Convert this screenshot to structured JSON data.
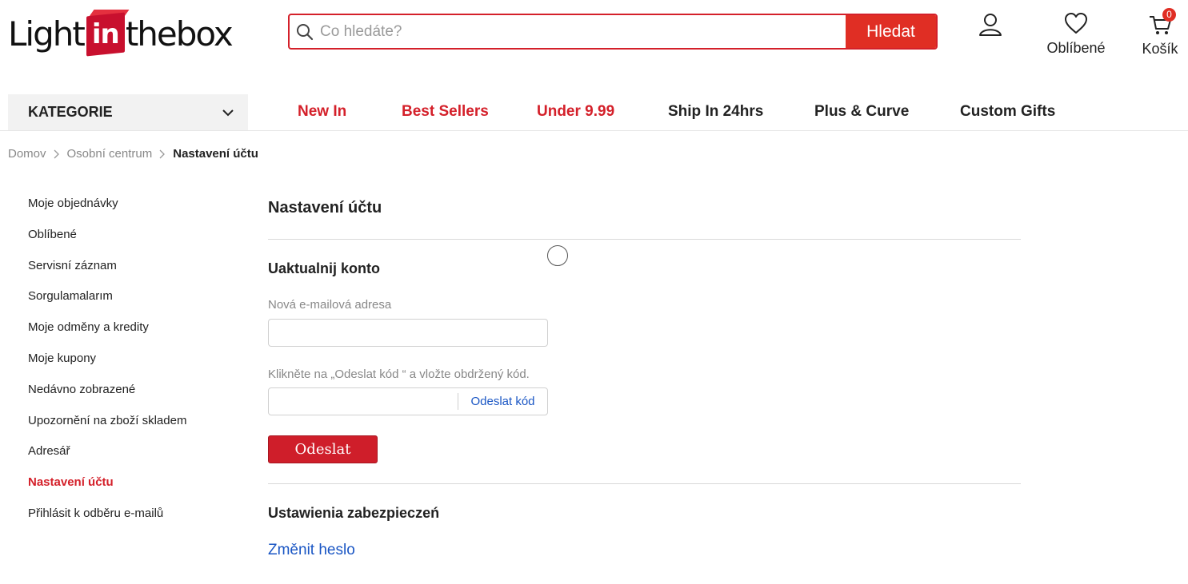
{
  "header": {
    "logo": {
      "part1": "Light",
      "part2": "in",
      "part3": "thebox"
    },
    "search": {
      "placeholder": "Co hledáte?",
      "button_label": "Hledat"
    },
    "wishlist_label": "Oblíbené",
    "cart_label": "Košík",
    "cart_count": "0"
  },
  "nav": {
    "category_label": "KATEGORIE",
    "items": [
      {
        "label": "New In",
        "color": "#d4202a"
      },
      {
        "label": "Best Sellers",
        "color": "#d4202a"
      },
      {
        "label": "Under 9.99",
        "color": "#d4202a"
      },
      {
        "label": "Ship In 24hrs",
        "color": "#222222"
      },
      {
        "label": "Plus & Curve",
        "color": "#222222"
      },
      {
        "label": "Custom Gifts",
        "color": "#222222"
      }
    ]
  },
  "breadcrumb": {
    "items": [
      "Domov",
      "Osobní centrum"
    ],
    "current": "Nastavení účtu"
  },
  "sidebar": {
    "items": [
      "Moje objednávky",
      "Oblíbené",
      "Servisní záznam",
      "Sorgulamalarım",
      "Moje odměny a kredity",
      "Moje kupony",
      "Nedávno zobrazené",
      "Upozornění na zboží skladem",
      "Adresář",
      "Nastavení účtu",
      "Přihlásit k odběru e-mailů"
    ],
    "active_index": 9
  },
  "main": {
    "title": "Nastavení účtu",
    "update_section": {
      "title": "Uaktualnij konto",
      "email_label": "Nová e-mailová adresa",
      "email_value": "",
      "code_instruction": "Klikněte na „Odeslat kód  “ a vložte obdržený kód.",
      "code_value": "",
      "send_code_label": "Odeslat kód",
      "submit_label": "Odeslat"
    },
    "security_section": {
      "title": "Ustawienia zabezpieczeń",
      "change_password_label": "Změnit heslo"
    }
  },
  "colors": {
    "brand_red": "#d4202a",
    "link_blue": "#1a56c4"
  }
}
